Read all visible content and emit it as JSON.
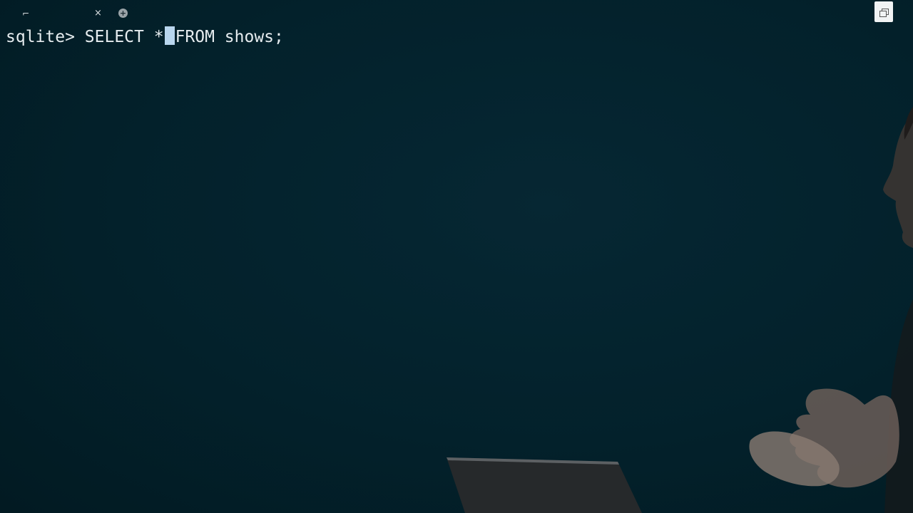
{
  "tabbar": {
    "terminal_icon": "⌐",
    "close_icon": "×",
    "new_tab_icon": "+"
  },
  "terminal": {
    "prompt": "sqlite> ",
    "command_before_cursor": "SELECT *",
    "command_after_cursor": "FROM shows;"
  },
  "icons": {
    "terminal": "terminal-icon",
    "close": "close-icon",
    "new_tab": "plus-circle-icon",
    "maximize": "restore-window-icon"
  },
  "colors": {
    "background": "#03202a",
    "text": "#e6ecef",
    "cursor": "#b9d6ee"
  }
}
